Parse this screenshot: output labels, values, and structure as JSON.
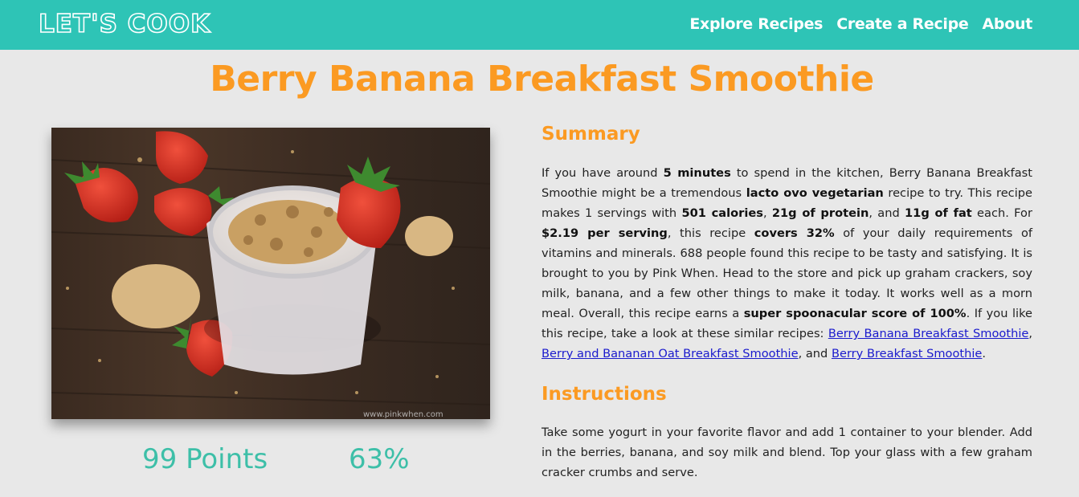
{
  "nav": {
    "logo": "LET'S COOK",
    "links": [
      "Explore Recipes",
      "Create a Recipe",
      "About"
    ]
  },
  "recipe": {
    "title": "Berry Banana Breakfast Smoothie",
    "image_watermark": "www.pinkwhen.com",
    "points": "99 Points",
    "percent": "63%",
    "summary_heading": "Summary",
    "summary": {
      "t1": "If you have around ",
      "b1": "5 minutes",
      "t2": " to spend in the kitchen, Berry Banana Breakfast Smoothie might be a tremendous ",
      "b2": "lacto ovo vegetarian",
      "t3": " recipe to try. This recipe makes 1 servings with ",
      "b3": "501 calories",
      "t4": ", ",
      "b4": "21g of protein",
      "t5": ", and ",
      "b5": "11g of fat",
      "t6": " each. For ",
      "b6": "$2.19 per serving",
      "t7": ", this recipe ",
      "b7": "covers 32%",
      "t8": " of your daily requirements of vitamins and minerals. 688 people found this recipe to be tasty and satisfying. It is brought to you by Pink When. Head to the store and pick up graham crackers, soy milk, banana, and a few other things to make it today. It works well as a morn meal. Overall, this recipe earns a ",
      "b8": "super spoonacular score of 100%",
      "t9": ". If you like this recipe, take a look at these similar recipes: ",
      "link1": "Berry Banana Breakfast Smoothie",
      "t10": ", ",
      "link2": "Berry and Bananan Oat Breakfast Smoothie",
      "t11": ", and ",
      "link3": "Berry Breakfast Smoothie",
      "t12": "."
    },
    "instructions_heading": "Instructions",
    "instructions": "Take some yogurt in your favorite flavor and add 1 container to your blender. Add in the berries, banana, and soy milk and blend. Top your glass with a few graham cracker crumbs and serve."
  },
  "colors": {
    "navbar": "#2ec4b6",
    "title": "#fb9a22",
    "stats": "#3dbfa8",
    "link": "#1a1acd",
    "background": "#e8e8e8"
  }
}
